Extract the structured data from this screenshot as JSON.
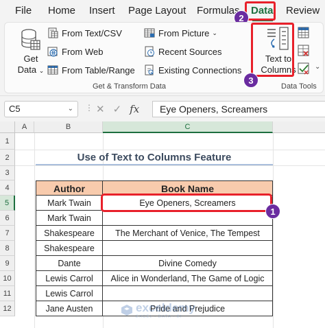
{
  "tabs": [
    {
      "label": "File"
    },
    {
      "label": "Home"
    },
    {
      "label": "Insert"
    },
    {
      "label": "Page Layout"
    },
    {
      "label": "Formulas"
    },
    {
      "label": "Data"
    },
    {
      "label": "Review"
    }
  ],
  "ribbon": {
    "get_data": {
      "line1": "Get",
      "line2": "Data"
    },
    "items": [
      {
        "label": "From Text/CSV",
        "icon": "text-csv-icon"
      },
      {
        "label": "From Web",
        "icon": "globe-icon"
      },
      {
        "label": "From Table/Range",
        "icon": "table-icon"
      },
      {
        "label": "From Picture",
        "icon": "picture-icon"
      },
      {
        "label": "Recent Sources",
        "icon": "recent-sources-icon"
      },
      {
        "label": "Existing Connections",
        "icon": "connections-icon"
      }
    ],
    "text_to_columns": {
      "line1": "Text to",
      "line2": "Columns"
    },
    "group_get_transform": "Get & Transform Data",
    "group_data_tools": "Data Tools"
  },
  "badges": [
    "1",
    "2",
    "3"
  ],
  "formula_bar": {
    "name_box": "C5",
    "fx": "fx",
    "value": "Eye Openers, Screamers"
  },
  "grid": {
    "columns": [
      "A",
      "B",
      "C"
    ],
    "rows": [
      "1",
      "2",
      "3",
      "4",
      "5",
      "6",
      "7",
      "8",
      "9",
      "10",
      "11",
      "12"
    ],
    "title": "Use of Text to Columns Feature",
    "headers": [
      "Author",
      "Book Name"
    ],
    "data": [
      [
        "Mark Twain",
        "Eye Openers, Screamers"
      ],
      [
        "Mark Twain",
        ""
      ],
      [
        "Shakespeare",
        "The Merchant of Venice, The Tempest"
      ],
      [
        "Shakespeare",
        ""
      ],
      [
        "Dante",
        "Divine Comedy"
      ],
      [
        "Lewis Carrol",
        "Alice in Wonderland, The Game of Logic"
      ],
      [
        "Lewis Carrol",
        ""
      ],
      [
        "Jane Austen",
        "Pride and Prejudice"
      ]
    ]
  },
  "watermark": {
    "name": "exceldemy",
    "tagline": "EXCEL · DATA · BI"
  },
  "colors": {
    "accent": "#1d6f3f",
    "highlight": "#e8202a",
    "badge": "#6a2ca0",
    "table_header": "#f8cbad"
  }
}
